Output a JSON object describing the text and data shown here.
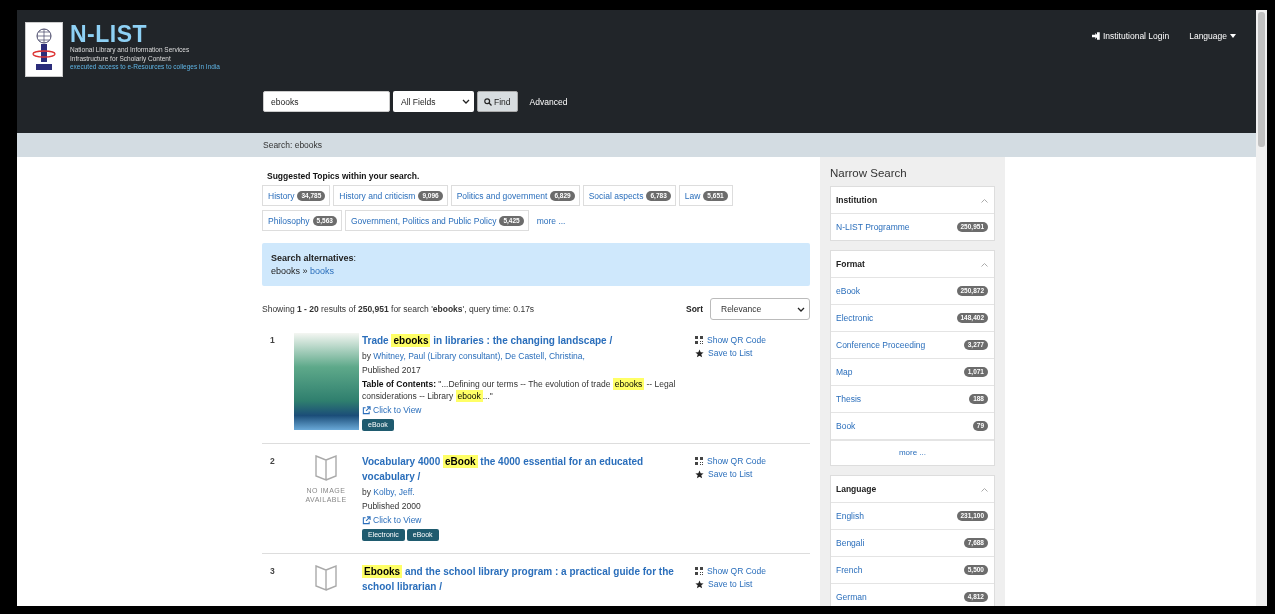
{
  "header": {
    "logo_title": "N-LIST",
    "logo_lines": [
      "National Library and Information Services",
      "Infrastructure for Scholarly Content",
      "executed access to e-Resources to colleges in India"
    ],
    "nav": [
      {
        "kind": "login",
        "label": "Institutional Login"
      },
      {
        "kind": "dropdown",
        "label": "Language"
      }
    ]
  },
  "search": {
    "value": "ebooks",
    "field": "All Fields",
    "button": "Find",
    "advanced": "Advanced"
  },
  "breadcrumb": "Search: ebooks",
  "topics": {
    "heading": "Suggested Topics within your search.",
    "items": [
      {
        "label": "History",
        "count": "34,785"
      },
      {
        "label": "History and criticism",
        "count": "9,096"
      },
      {
        "label": "Politics and government",
        "count": "6,829"
      },
      {
        "label": "Social aspects",
        "count": "6,783"
      },
      {
        "label": "Law",
        "count": "5,651"
      },
      {
        "label": "Philosophy",
        "count": "5,563"
      },
      {
        "label": "Government, Politics and Public Policy",
        "count": "5,425"
      }
    ],
    "more": "more ..."
  },
  "alternatives": {
    "heading": "**Search alternatives**:",
    "query": "ebooks »",
    "suggestion": "books"
  },
  "results_summary": "Showing **1 - 20** results of **250,951** for search '**ebooks**', query time: 0.17s",
  "sort": {
    "label": "Sort",
    "value": "Relevance"
  },
  "results": [
    {
      "number": "1",
      "cover": {
        "kind": "photo"
      },
      "title": [
        {
          "text": "Trade ",
          "highlight": false
        },
        {
          "text": "ebooks",
          "highlight": true
        },
        {
          "text": " in libraries : the changing landscape /",
          "highlight": false
        }
      ],
      "authors_prefix": "by",
      "authors": [
        "Whitney, Paul (Library consultant),",
        "De Castell, Christina,"
      ],
      "published": "Published 2017",
      "toc_label": "Table of Contents:",
      "toc": [
        {
          "text": "\"...Defining our terms -- The evolution of trade ",
          "highlight": false
        },
        {
          "text": "ebooks",
          "highlight": true
        },
        {
          "text": " -- Legal considerations -- Library ",
          "highlight": false
        },
        {
          "text": "ebook",
          "highlight": true
        },
        {
          "text": "...\"",
          "highlight": false
        }
      ],
      "link": "Click to View",
      "formats": [
        "eBook"
      ],
      "actions": [
        {
          "kind": "qr",
          "label": "Show QR Code"
        },
        {
          "kind": "save",
          "label": "Save to List"
        }
      ]
    },
    {
      "number": "2",
      "cover": {
        "kind": "none",
        "text": "NO IMAGE AVAILABLE"
      },
      "title": [
        {
          "text": "Vocabulary 4000 ",
          "highlight": false
        },
        {
          "text": "eBook",
          "highlight": true
        },
        {
          "text": " the 4000 essential for an educated vocabulary /",
          "highlight": false
        }
      ],
      "authors_prefix": "by",
      "authors": [
        "Kolby, Jeff."
      ],
      "published": "Published 2000",
      "link": "Click to View",
      "formats": [
        "Electronic",
        "eBook"
      ],
      "actions": [
        {
          "kind": "qr",
          "label": "Show QR Code"
        },
        {
          "kind": "save",
          "label": "Save to List"
        }
      ]
    },
    {
      "number": "3",
      "cover": {
        "kind": "none"
      },
      "title": [
        {
          "text": "Ebooks",
          "highlight": true
        },
        {
          "text": " and the school library program : a practical guide for the school librarian /",
          "highlight": false
        }
      ],
      "actions": [
        {
          "kind": "qr",
          "label": "Show QR Code"
        },
        {
          "kind": "save",
          "label": "Save to List"
        }
      ]
    }
  ],
  "sidebar": {
    "heading": "Narrow Search",
    "facets": [
      {
        "title": "Institution",
        "expanded": true,
        "items": [
          {
            "label": "N-LIST Programme",
            "count": "250,951"
          }
        ]
      },
      {
        "title": "Format",
        "expanded": true,
        "items": [
          {
            "label": "eBook",
            "count": "250,872"
          },
          {
            "label": "Electronic",
            "count": "148,402"
          },
          {
            "label": "Conference Proceeding",
            "count": "3,277"
          },
          {
            "label": "Map",
            "count": "1,071"
          },
          {
            "label": "Thesis",
            "count": "188"
          },
          {
            "label": "Book",
            "count": "79"
          }
        ],
        "more": "more ..."
      },
      {
        "title": "Language",
        "expanded": true,
        "items": [
          {
            "label": "English",
            "count": "231,100"
          },
          {
            "label": "Bengali",
            "count": "7,688"
          },
          {
            "label": "French",
            "count": "5,500"
          },
          {
            "label": "German",
            "count": "4,812"
          }
        ]
      }
    ]
  }
}
